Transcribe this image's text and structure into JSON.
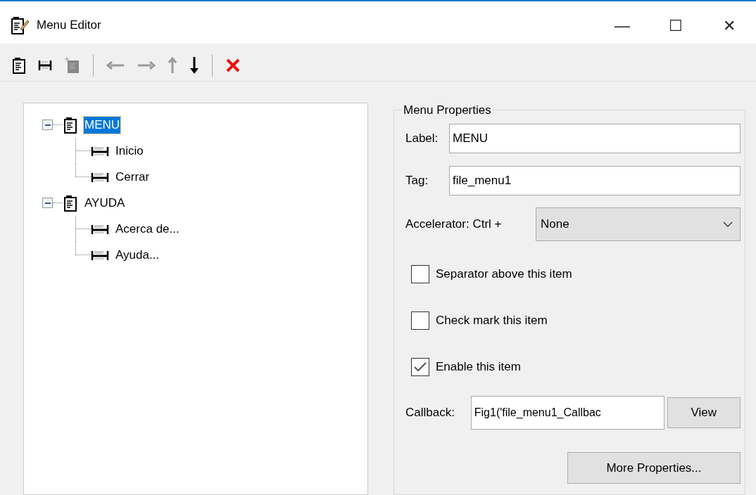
{
  "window": {
    "title": "Menu Editor",
    "controls": [
      "—",
      "☐",
      "✕"
    ]
  },
  "toolbar": [
    {
      "kind": "new-menu",
      "disabled": false
    },
    {
      "kind": "new-item",
      "disabled": false
    },
    {
      "kind": "new-context",
      "disabled": true
    },
    {
      "kind": "separator"
    },
    {
      "kind": "left",
      "disabled": true
    },
    {
      "kind": "right",
      "disabled": true
    },
    {
      "kind": "up",
      "disabled": true
    },
    {
      "kind": "down",
      "disabled": false
    },
    {
      "kind": "separator"
    },
    {
      "kind": "delete",
      "disabled": false
    }
  ],
  "tree": [
    {
      "label": "MENU",
      "expanded": true,
      "selected": true,
      "children": [
        {
          "label": "Inicio",
          "selected": false
        },
        {
          "label": "Cerrar",
          "selected": false
        }
      ]
    },
    {
      "label": "AYUDA",
      "expanded": true,
      "selected": false,
      "children": [
        {
          "label": "Acerca de...",
          "selected": false
        },
        {
          "label": "Ayuda...",
          "selected": false
        }
      ]
    }
  ],
  "properties": {
    "title": "Menu Properties",
    "label": {
      "label": "Label:",
      "value": "MENU"
    },
    "tag": {
      "label": "Tag:",
      "value": "file_menu1"
    },
    "accelerator": {
      "label": "Accelerator: Ctrl +",
      "value": "None"
    },
    "checkboxes": [
      {
        "label": "Separator above this item",
        "checked": false
      },
      {
        "label": "Check mark this item",
        "checked": false
      },
      {
        "label": "Enable this item",
        "checked": true
      }
    ],
    "callback": {
      "label": "Callback:",
      "value": "Fig1('file_menu1_Callbac",
      "button": "View"
    },
    "more_button": "More Properties..."
  }
}
